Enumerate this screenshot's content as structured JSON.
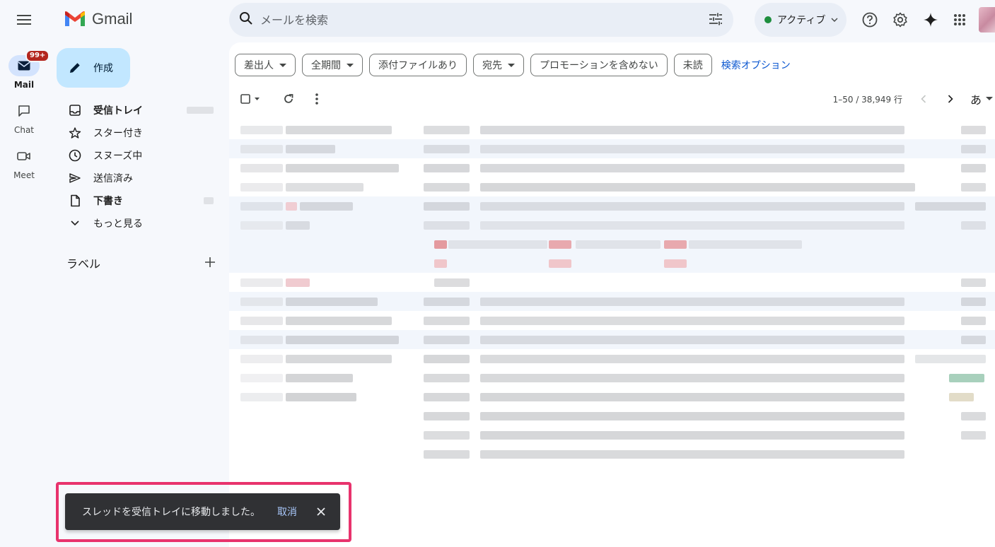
{
  "app": {
    "logo_text": "Gmail"
  },
  "rail": {
    "items": [
      {
        "label": "Mail",
        "icon": "mail-icon",
        "badge": "99+"
      },
      {
        "label": "Chat",
        "icon": "chat-icon"
      },
      {
        "label": "Meet",
        "icon": "video-icon"
      }
    ]
  },
  "sidebar": {
    "compose_label": "作成",
    "nav": [
      {
        "label": "受信トレイ",
        "icon": "inbox-icon"
      },
      {
        "label": "スター付き",
        "icon": "star-icon"
      },
      {
        "label": "スヌーズ中",
        "icon": "clock-icon"
      },
      {
        "label": "送信済み",
        "icon": "send-icon"
      },
      {
        "label": "下書き",
        "icon": "draft-icon"
      },
      {
        "label": "もっと見る",
        "icon": "chevron-down-icon"
      }
    ],
    "labels_heading": "ラベル"
  },
  "search": {
    "placeholder": "メールを検索"
  },
  "status": {
    "label": "アクティブ",
    "color": "#1e8e3e"
  },
  "filters": {
    "chips": [
      "差出人",
      "全期間",
      "添付ファイルあり",
      "宛先",
      "プロモーションを含めない",
      "未読"
    ],
    "advanced_link": "検索オプション"
  },
  "toolbar": {
    "range": "1–50 / 38,949 行",
    "input_tool": "あ"
  },
  "snackbar": {
    "message": "スレッドを受信トレイに移動しました。",
    "undo_label": "取消"
  },
  "colors": {
    "accent": "#0b57d0",
    "compose_bg": "#c2e7ff",
    "snackbar_bg": "#303134",
    "highlight_border": "#e8336d",
    "badge_bg": "#b3261e"
  }
}
